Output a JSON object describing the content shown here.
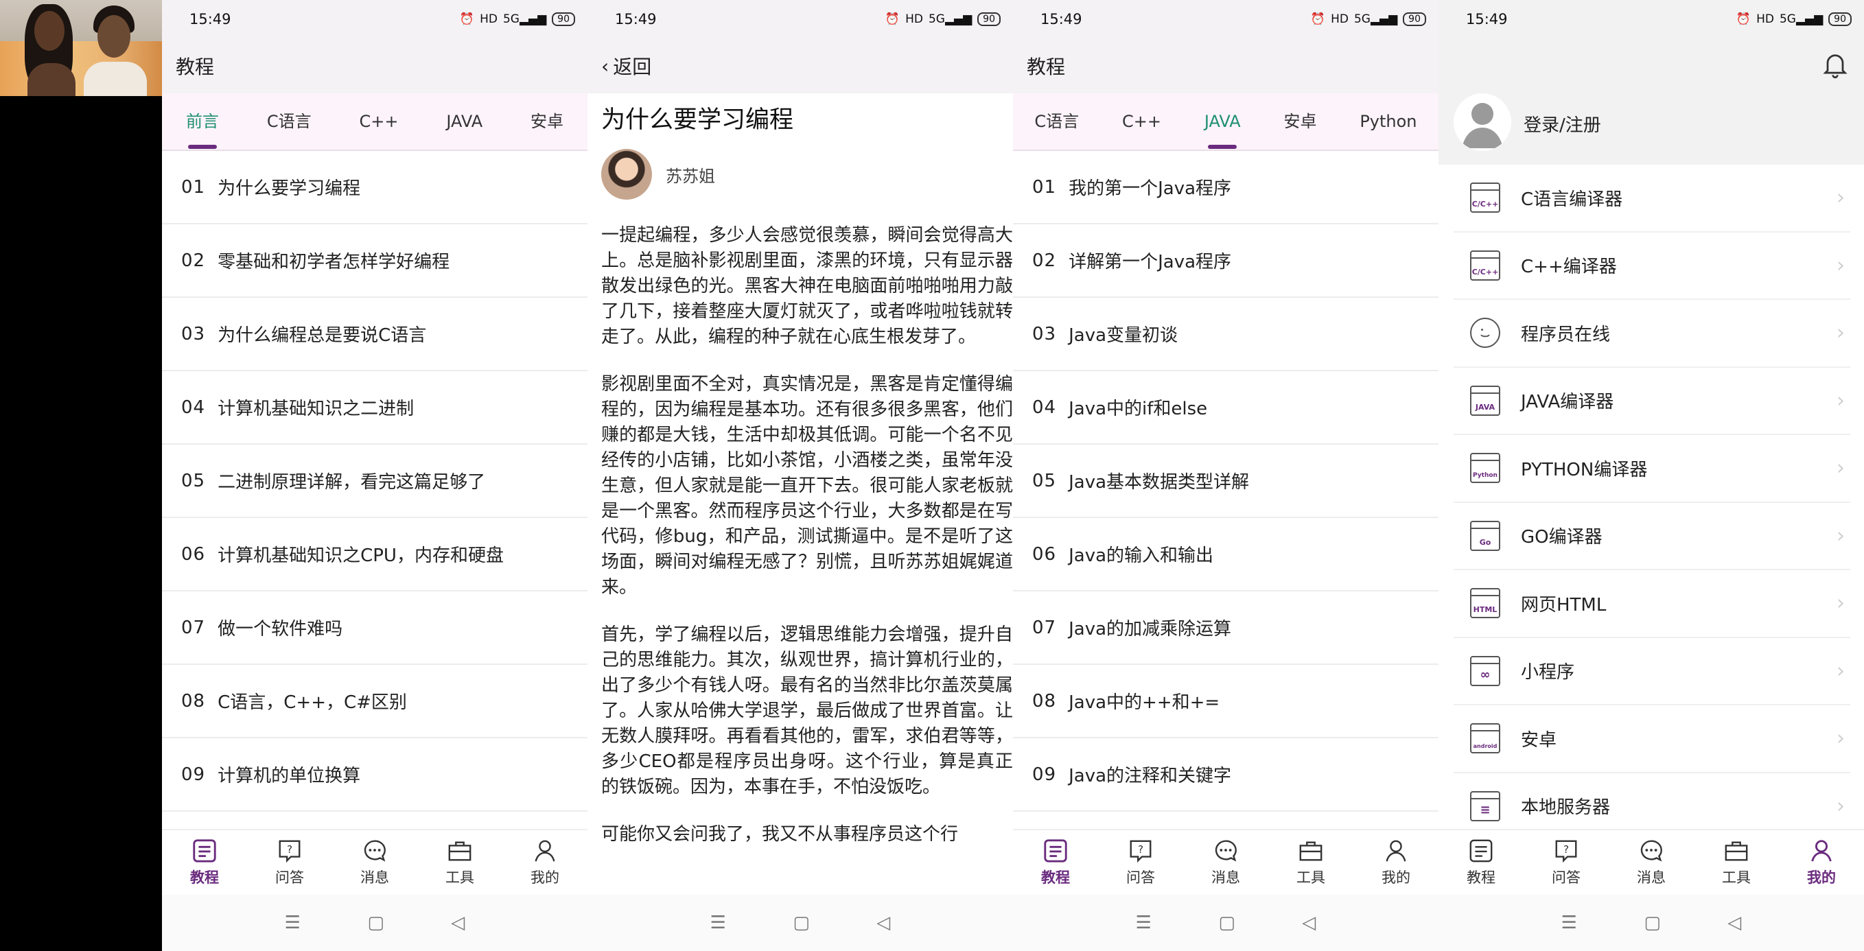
{
  "status": {
    "time": "15:49",
    "signal": "5G",
    "battery": "90"
  },
  "screen1": {
    "title": "教程",
    "tabs": [
      "前言",
      "C语言",
      "C++",
      "JAVA",
      "安卓"
    ],
    "lessons": [
      {
        "num": "01",
        "title": "为什么要学习编程"
      },
      {
        "num": "02",
        "title": "零基础和初学者怎样学好编程"
      },
      {
        "num": "03",
        "title": "为什么编程总是要说C语言"
      },
      {
        "num": "04",
        "title": "计算机基础知识之二进制"
      },
      {
        "num": "05",
        "title": "二进制原理详解，看完这篇足够了"
      },
      {
        "num": "06",
        "title": "计算机基础知识之CPU，内存和硬盘"
      },
      {
        "num": "07",
        "title": "做一个软件难吗"
      },
      {
        "num": "08",
        "title": "C语言，C++，C#区别"
      },
      {
        "num": "09",
        "title": "计算机的单位换算"
      }
    ]
  },
  "screen2": {
    "back": "返回",
    "title": "为什么要学习编程",
    "author": "苏苏姐",
    "paragraphs": [
      "一提起编程，多少人会感觉很羡慕，瞬间会觉得高大上。总是脑补影视剧里面，漆黑的环境，只有显示器散发出绿色的光。黑客大神在电脑面前啪啪啪用力敲了几下，接着整座大厦灯就灭了，或者哗啦啦钱就转走了。从此，编程的种子就在心底生根发芽了。",
      "影视剧里面不全对，真实情况是，黑客是肯定懂得编程的，因为编程是基本功。还有很多很多黑客，他们赚的都是大钱，生活中却极其低调。可能一个名不见经传的小店铺，比如小茶馆，小酒楼之类，虽常年没生意，但人家就是能一直开下去。很可能人家老板就是一个黑客。然而程序员这个行业，大多数都是在写代码，修bug，和产品，测试撕逼中。是不是听了这场面，瞬间对编程无感了？别慌，且听苏苏姐娓娓道来。",
      "首先，学了编程以后，逻辑思维能力会增强，提升自己的思维能力。其次，纵观世界，搞计算机行业的，出了多少个有钱人呀。最有名的当然非比尔盖茨莫属了。人家从哈佛大学退学，最后做成了世界首富。让无数人膜拜呀。再看看其他的，雷军，求伯君等等，多少CEO都是程序员出身呀。这个行业，算是真正的铁饭碗。因为，本事在手，不怕没饭吃。",
      "可能你又会问我了，我又不从事程序员这个行"
    ]
  },
  "screen3": {
    "title": "教程",
    "tabs": [
      "C语言",
      "C++",
      "JAVA",
      "安卓",
      "Python"
    ],
    "lessons": [
      {
        "num": "01",
        "title": "我的第一个Java程序"
      },
      {
        "num": "02",
        "title": "详解第一个Java程序"
      },
      {
        "num": "03",
        "title": "Java变量初谈"
      },
      {
        "num": "04",
        "title": "Java中的if和else"
      },
      {
        "num": "05",
        "title": "Java基本数据类型详解"
      },
      {
        "num": "06",
        "title": "Java的输入和输出"
      },
      {
        "num": "07",
        "title": "Java的加减乘除运算"
      },
      {
        "num": "08",
        "title": "Java中的++和+="
      },
      {
        "num": "09",
        "title": "Java的注释和关键字"
      }
    ]
  },
  "screen4": {
    "login": "登录/注册",
    "menu": [
      {
        "label": "C语言编译器",
        "icon_text": "C/C++"
      },
      {
        "label": "C++编译器",
        "icon_text": "C/C++"
      },
      {
        "label": "程序员在线",
        "icon_text": ""
      },
      {
        "label": "JAVA编译器",
        "icon_text": "JAVA"
      },
      {
        "label": "PYTHON编译器",
        "icon_text": "Python"
      },
      {
        "label": "GO编译器",
        "icon_text": "Go"
      },
      {
        "label": "网页HTML",
        "icon_text": "HTML"
      },
      {
        "label": "小程序",
        "icon_text": "∞"
      },
      {
        "label": "安卓",
        "icon_text": "android"
      },
      {
        "label": "本地服务器",
        "icon_text": "≡"
      }
    ]
  },
  "nav": [
    "教程",
    "问答",
    "消息",
    "工具",
    "我的"
  ],
  "sysnav": [
    "☰",
    "▢",
    "◁"
  ],
  "colors": {
    "accent": "#6a2b7e",
    "tab_active": "#1e8f72",
    "tab_bg": "#fdf3fb"
  }
}
